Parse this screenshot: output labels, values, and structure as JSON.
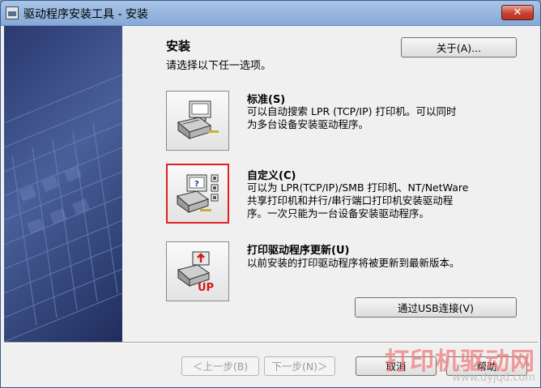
{
  "window": {
    "title": "驱动程序安装工具 - 安装",
    "close_label": "✕"
  },
  "header": {
    "title": "安装",
    "subtitle": "请选择以下任一选项。",
    "about_label": "关于(A)..."
  },
  "options": [
    {
      "title": "标准(S)",
      "description": "可以自动搜索 LPR (TCP/IP) 打印机。可以同时\n为多台设备安装驱动程序。",
      "icon": "printer-computer-icon"
    },
    {
      "title": "自定义(C)",
      "description": "可以为 LPR(TCP/IP)/SMB 打印机、NT/NetWare\n共享打印机和并行/串行端口打印机安装驱动程\n序。一次只能为一台设备安装驱动程序。",
      "icon": "printer-custom-icon"
    },
    {
      "title": "打印驱动程序更新(U)",
      "description": "以前安装的打印驱动程序将被更新到最新版本。",
      "icon": "printer-update-icon",
      "badge": "UP"
    }
  ],
  "usb_label": "通过USB连接(V)",
  "footer": {
    "back_label": "＜上一步(B)",
    "next_label": "下一步(N)＞",
    "cancel_label": "取消",
    "help_label": "帮助"
  },
  "watermark": {
    "main": "打印机驱动网",
    "sub": "www.dyjqd.com"
  },
  "colors": {
    "selection_border": "#e02020",
    "side_panel": "#34467f",
    "title_bar": "#9bbbe3"
  }
}
